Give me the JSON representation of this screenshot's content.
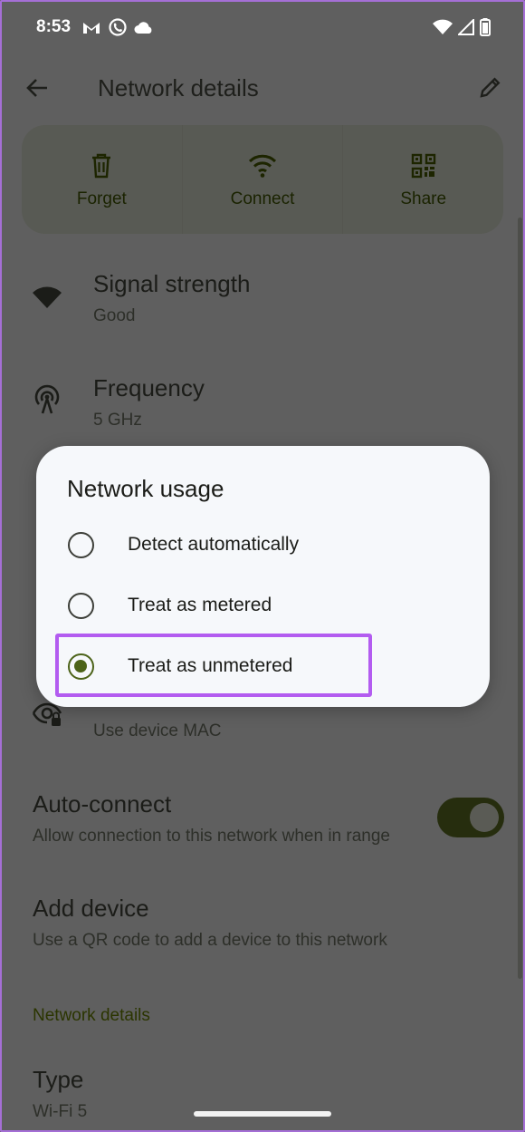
{
  "status_bar": {
    "time": "8:53",
    "left_icons": [
      "gmail-icon",
      "whatsapp-icon",
      "cloud-icon"
    ],
    "right_icons": [
      "wifi-icon",
      "cell-signal-icon",
      "battery-icon"
    ]
  },
  "app_bar": {
    "title": "Network details"
  },
  "actions": [
    {
      "label": "Forget",
      "icon": "trash-icon"
    },
    {
      "label": "Connect",
      "icon": "wifi-icon"
    },
    {
      "label": "Share",
      "icon": "qr-code-icon"
    }
  ],
  "details": {
    "signal": {
      "title": "Signal strength",
      "value": "Good"
    },
    "frequency": {
      "title": "Frequency",
      "value": "5 GHz"
    },
    "privacy": {
      "value": "Use device MAC"
    },
    "auto_connect": {
      "title": "Auto-connect",
      "subtitle": "Allow connection to this network when in range",
      "enabled": true
    },
    "add_device": {
      "title": "Add device",
      "subtitle": "Use a QR code to add a device to this network"
    },
    "section_header": "Network details",
    "type": {
      "title": "Type",
      "value": "Wi-Fi 5"
    }
  },
  "dialog": {
    "title": "Network usage",
    "options": [
      {
        "label": "Detect automatically",
        "selected": false
      },
      {
        "label": "Treat as metered",
        "selected": false
      },
      {
        "label": "Treat as unmetered",
        "selected": true
      }
    ]
  },
  "colors": {
    "accent": "#4c6319",
    "highlight": "#b35cf0",
    "scrim_background": "#5f5f5f"
  }
}
